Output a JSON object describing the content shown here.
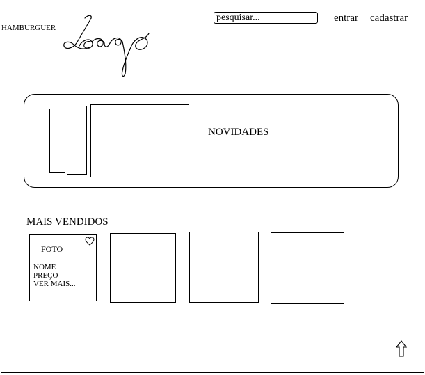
{
  "header": {
    "brand": "HAMBURGUER",
    "search_placeholder": "pesquisar...",
    "login_label": "entrar",
    "signup_label": "cadastrar",
    "logo_icon": "handwritten-logo"
  },
  "featured": {
    "label": "NOVIDADES"
  },
  "best_sellers": {
    "title": "MAIS VENDIDOS",
    "cards": [
      {
        "photo_label": "FOTO",
        "name_label": "NOME",
        "price_label": "PREÇO",
        "more_label": "VER MAIS...",
        "favorite_icon": "heart-icon"
      },
      {},
      {},
      {}
    ]
  },
  "footer": {
    "back_to_top_icon": "arrow-up-icon"
  }
}
